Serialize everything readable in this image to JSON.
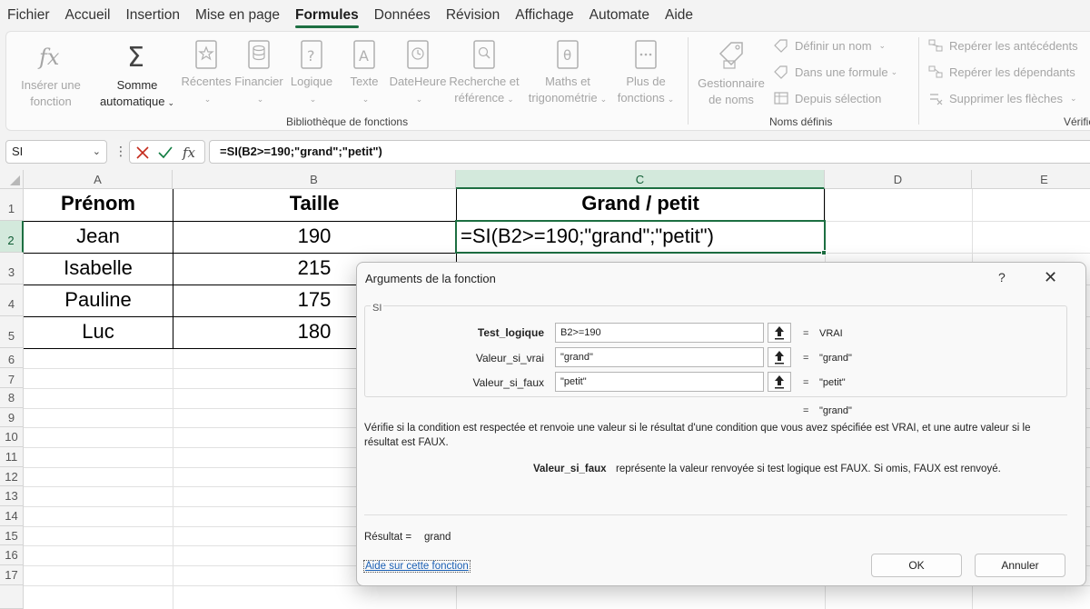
{
  "menu": {
    "items": [
      "Fichier",
      "Accueil",
      "Insertion",
      "Mise en page",
      "Formules",
      "Données",
      "Révision",
      "Affichage",
      "Automate",
      "Aide"
    ],
    "active": "Formules"
  },
  "ribbon": {
    "insert_function": {
      "line1": "Insérer une",
      "line2": "fonction",
      "icon": "fx-icon"
    },
    "autosum": {
      "line1": "Somme",
      "line2": "automatique",
      "icon": "sigma-icon"
    },
    "library_buttons": [
      {
        "label": "Récentes",
        "icon": "star-book-icon"
      },
      {
        "label": "Financier",
        "icon": "coins-book-icon"
      },
      {
        "label": "Logique",
        "icon": "question-book-icon"
      },
      {
        "label": "Texte",
        "icon": "letter-a-book-icon"
      },
      {
        "label": "DateHeure",
        "icon": "clock-book-icon"
      }
    ],
    "lookup": {
      "line1": "Recherche et",
      "line2": "référence",
      "icon": "magnifier-book-icon"
    },
    "math": {
      "line1": "Maths et",
      "line2": "trigonométrie",
      "icon": "theta-book-icon"
    },
    "more": {
      "line1": "Plus de",
      "line2": "fonctions",
      "icon": "dots-book-icon"
    },
    "library_label": "Bibliothèque de fonctions",
    "name_manager": {
      "line1": "Gestionnaire",
      "line2": "de noms",
      "icon": "tag-icon"
    },
    "define_name": "Définir un nom",
    "use_in_formula": "Dans une formule",
    "create_from_selection": "Depuis sélection",
    "names_label": "Noms définis",
    "trace_precedents": "Repérer les antécédents",
    "trace_dependents": "Repérer les dépendants",
    "remove_arrows": "Supprimer les flèches",
    "audit_label": "Vérific"
  },
  "formula_bar": {
    "name_box": "SI",
    "formula": "=SI(B2>=190;\"grand\";\"petit\")"
  },
  "sheet": {
    "columns": [
      "A",
      "B",
      "C",
      "D",
      "E"
    ],
    "rows": [
      "1",
      "2",
      "3",
      "4",
      "5",
      "6",
      "7",
      "8",
      "9",
      "10",
      "11",
      "12",
      "13",
      "14",
      "15",
      "16",
      "17"
    ],
    "headers": [
      "Prénom",
      "Taille",
      "Grand / petit"
    ],
    "data": [
      {
        "name": "Jean",
        "height": "190",
        "result": "=SI(B2>=190;\"grand\";\"petit\")"
      },
      {
        "name": "Isabelle",
        "height": "215"
      },
      {
        "name": "Pauline",
        "height": "175"
      },
      {
        "name": "Luc",
        "height": "180"
      }
    ]
  },
  "dialog": {
    "title": "Arguments de la fonction",
    "help_glyph": "?",
    "close_glyph": "✕",
    "function_name": "SI",
    "args": [
      {
        "label": "Test_logique",
        "value": "B2>=190",
        "result": "VRAI",
        "required": true
      },
      {
        "label": "Valeur_si_vrai",
        "value": "\"grand\"",
        "result": "\"grand\"",
        "required": false
      },
      {
        "label": "Valeur_si_faux",
        "value": "\"petit\"",
        "result": "\"petit\"",
        "required": false
      }
    ],
    "equals": "=",
    "overall_result": "\"grand\"",
    "description": "Vérifie si la condition est respectée et renvoie une valeur si le résultat d'une condition que vous avez spécifiée est VRAI, et une autre valeur si le résultat est FAUX.",
    "arg_help_name": "Valeur_si_faux",
    "arg_help_text": "représente la valeur renvoyée si test logique est FAUX. Si omis, FAUX est renvoyé.",
    "result_label": "Résultat =",
    "result_value": "grand",
    "help_link": "Aide sur cette fonction",
    "ok_label": "OK",
    "cancel_label": "Annuler"
  }
}
